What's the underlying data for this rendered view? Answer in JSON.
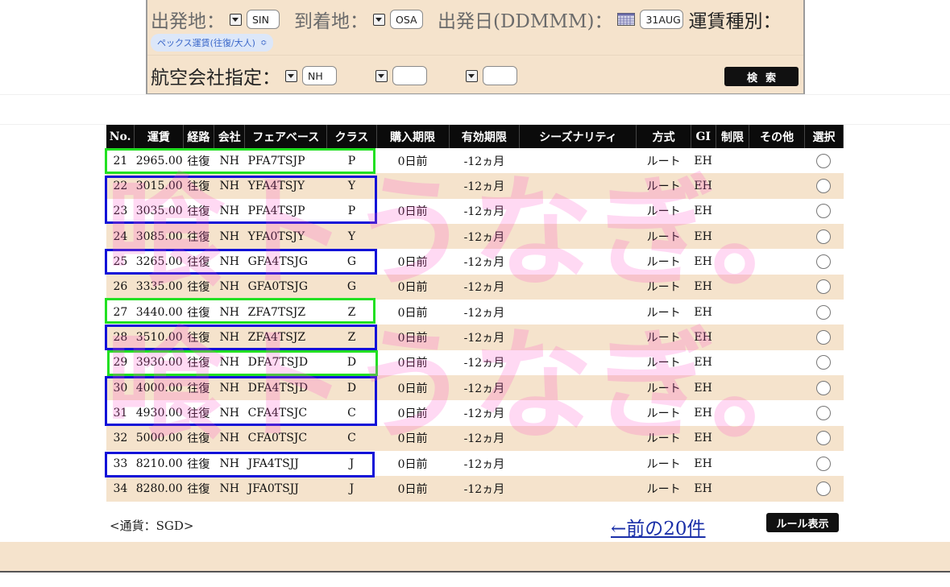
{
  "search": {
    "origin_label": "出発地：",
    "origin_value": "SIN",
    "destination_label": "到着地：",
    "destination_value": "OSA",
    "date_label": "出発日(DDMMM)：",
    "date_value": "31AUG",
    "fare_type_label": "運賃種別：",
    "fare_type_value": "ペックス運賃(往復/大人)",
    "airline_label": "航空会社指定：",
    "airline_value": "NH",
    "airline2_value": "",
    "airline3_value": "",
    "search_button": "検索"
  },
  "table": {
    "headers": [
      "No.",
      "運賃",
      "経路",
      "会社",
      "フェアベース",
      "クラス",
      "購入期限",
      "有効期限",
      "シーズナリティ",
      "方式",
      "GI",
      "制限",
      "その他",
      "選択"
    ],
    "rows": [
      {
        "no": "21",
        "fare": "2965.00",
        "route": "往復",
        "carrier": "NH",
        "fare_basis": "PFA7TSJP",
        "class": "P",
        "purchase": "0日前",
        "validity": "-12ヵ月",
        "season": "",
        "method": "ルート",
        "gi": "EH",
        "restriction": "",
        "other": ""
      },
      {
        "no": "22",
        "fare": "3015.00",
        "route": "往復",
        "carrier": "NH",
        "fare_basis": "YFA4TSJY",
        "class": "Y",
        "purchase": "",
        "validity": "-12ヵ月",
        "season": "",
        "method": "ルート",
        "gi": "EH",
        "restriction": "",
        "other": ""
      },
      {
        "no": "23",
        "fare": "3035.00",
        "route": "往復",
        "carrier": "NH",
        "fare_basis": "PFA4TSJP",
        "class": "P",
        "purchase": "0日前",
        "validity": "-12ヵ月",
        "season": "",
        "method": "ルート",
        "gi": "EH",
        "restriction": "",
        "other": ""
      },
      {
        "no": "24",
        "fare": "3085.00",
        "route": "往復",
        "carrier": "NH",
        "fare_basis": "YFA0TSJY",
        "class": "Y",
        "purchase": "",
        "validity": "-12ヵ月",
        "season": "",
        "method": "ルート",
        "gi": "EH",
        "restriction": "",
        "other": ""
      },
      {
        "no": "25",
        "fare": "3265.00",
        "route": "往復",
        "carrier": "NH",
        "fare_basis": "GFA4TSJG",
        "class": "G",
        "purchase": "0日前",
        "validity": "-12ヵ月",
        "season": "",
        "method": "ルート",
        "gi": "EH",
        "restriction": "",
        "other": ""
      },
      {
        "no": "26",
        "fare": "3335.00",
        "route": "往復",
        "carrier": "NH",
        "fare_basis": "GFA0TSJG",
        "class": "G",
        "purchase": "0日前",
        "validity": "-12ヵ月",
        "season": "",
        "method": "ルート",
        "gi": "EH",
        "restriction": "",
        "other": ""
      },
      {
        "no": "27",
        "fare": "3440.00",
        "route": "往復",
        "carrier": "NH",
        "fare_basis": "ZFA7TSJZ",
        "class": "Z",
        "purchase": "0日前",
        "validity": "-12ヵ月",
        "season": "",
        "method": "ルート",
        "gi": "EH",
        "restriction": "",
        "other": ""
      },
      {
        "no": "28",
        "fare": "3510.00",
        "route": "往復",
        "carrier": "NH",
        "fare_basis": "ZFA4TSJZ",
        "class": "Z",
        "purchase": "0日前",
        "validity": "-12ヵ月",
        "season": "",
        "method": "ルート",
        "gi": "EH",
        "restriction": "",
        "other": ""
      },
      {
        "no": "29",
        "fare": "3930.00",
        "route": "往復",
        "carrier": "NH",
        "fare_basis": "DFA7TSJD",
        "class": "D",
        "purchase": "0日前",
        "validity": "-12ヵ月",
        "season": "",
        "method": "ルート",
        "gi": "EH",
        "restriction": "",
        "other": ""
      },
      {
        "no": "30",
        "fare": "4000.00",
        "route": "往復",
        "carrier": "NH",
        "fare_basis": "DFA4TSJD",
        "class": "D",
        "purchase": "0日前",
        "validity": "-12ヵ月",
        "season": "",
        "method": "ルート",
        "gi": "EH",
        "restriction": "",
        "other": ""
      },
      {
        "no": "31",
        "fare": "4930.00",
        "route": "往復",
        "carrier": "NH",
        "fare_basis": "CFA4TSJC",
        "class": "C",
        "purchase": "0日前",
        "validity": "-12ヵ月",
        "season": "",
        "method": "ルート",
        "gi": "EH",
        "restriction": "",
        "other": ""
      },
      {
        "no": "32",
        "fare": "5000.00",
        "route": "往復",
        "carrier": "NH",
        "fare_basis": "CFA0TSJC",
        "class": "C",
        "purchase": "0日前",
        "validity": "-12ヵ月",
        "season": "",
        "method": "ルート",
        "gi": "EH",
        "restriction": "",
        "other": ""
      },
      {
        "no": "33",
        "fare": "8210.00",
        "route": "往復",
        "carrier": "NH",
        "fare_basis": "JFA4TSJJ",
        "class": "J",
        "purchase": "0日前",
        "validity": "-12ヵ月",
        "season": "",
        "method": "ルート",
        "gi": "EH",
        "restriction": "",
        "other": ""
      },
      {
        "no": "34",
        "fare": "8280.00",
        "route": "往復",
        "carrier": "NH",
        "fare_basis": "JFA0TSJJ",
        "class": "J",
        "purchase": "0日前",
        "validity": "-12ヵ月",
        "season": "",
        "method": "ルート",
        "gi": "EH",
        "restriction": "",
        "other": ""
      }
    ]
  },
  "footer": {
    "currency": "<通貨：SGD>",
    "prev_link": "←前の20件",
    "rule_button": "ルール表示"
  },
  "watermark_text": "喰トうなぎ。",
  "colors": {
    "panel_bg": "#f5e3cc",
    "header_bg": "#0b0b0b",
    "highlight_green": "#22e022",
    "highlight_blue": "#1212d8",
    "link": "#1a2fa8",
    "watermark": "#ff50c8"
  }
}
